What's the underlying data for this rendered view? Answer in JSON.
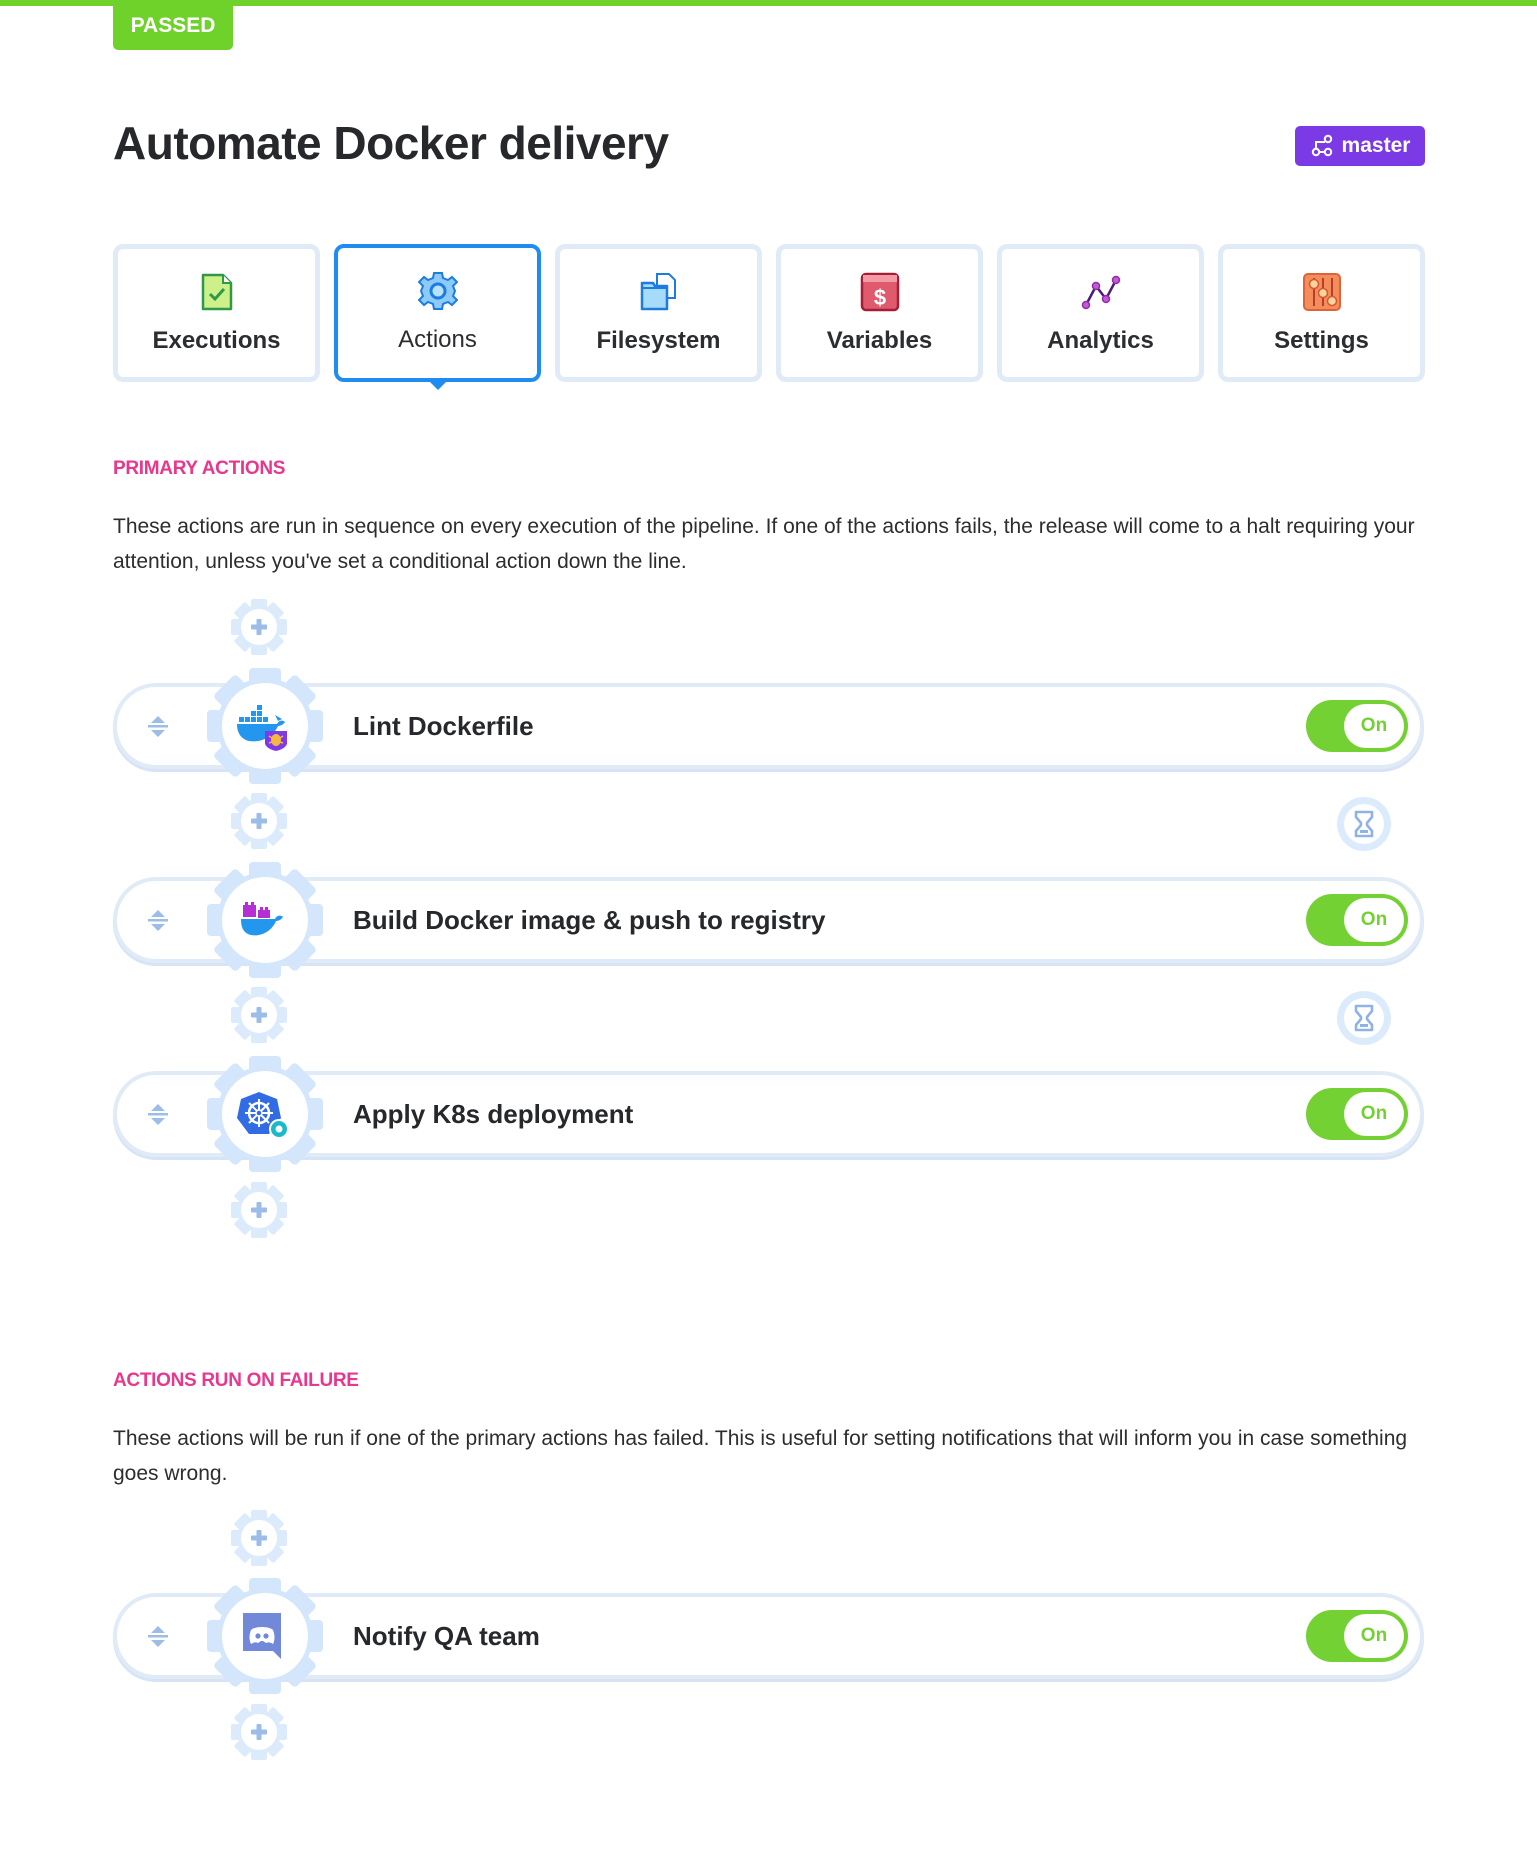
{
  "status": {
    "label": "PASSED",
    "color": "#6fd22a"
  },
  "pipeline": {
    "title": "Automate Docker delivery",
    "branch": "master",
    "branch_color": "#7c3ae6"
  },
  "tabs": [
    {
      "label": "Executions",
      "icon": "file-check-icon"
    },
    {
      "label": "Actions",
      "icon": "gear-icon",
      "active": true
    },
    {
      "label": "Filesystem",
      "icon": "folder-files-icon"
    },
    {
      "label": "Variables",
      "icon": "dollar-icon"
    },
    {
      "label": "Analytics",
      "icon": "line-chart-icon"
    },
    {
      "label": "Settings",
      "icon": "sliders-icon"
    }
  ],
  "primary": {
    "heading": "PRIMARY ACTIONS",
    "description": "These actions are run in sequence on every execution of the pipeline. If one of the actions fails, the release will come to a halt requiring your attention, unless you've set a conditional action down the line.",
    "actions": [
      {
        "name": "Lint Dockerfile",
        "icon": "docker-lint-icon",
        "toggle": "On"
      },
      {
        "name": "Build Docker image & push to registry",
        "icon": "docker-build-icon",
        "toggle": "On"
      },
      {
        "name": "Apply K8s deployment",
        "icon": "kubernetes-icon",
        "toggle": "On"
      }
    ]
  },
  "failure": {
    "heading": "ACTIONS RUN ON FAILURE",
    "description": "These actions will be run if one of the primary actions has failed. This is useful for setting notifications that will inform you in case something goes wrong.",
    "actions": [
      {
        "name": "Notify QA team",
        "icon": "discord-icon",
        "toggle": "On"
      }
    ]
  }
}
